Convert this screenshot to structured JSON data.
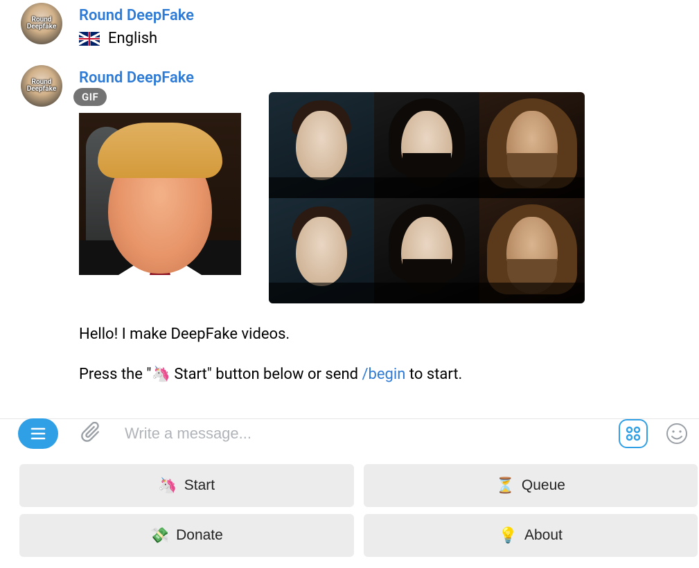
{
  "bot": {
    "name": "Round DeepFake",
    "avatar_label": "Round\nDeepfake"
  },
  "messages": {
    "lang_label": "English",
    "gif_badge": "GIF",
    "greeting": "Hello! I make DeepFake videos.",
    "instruction_pre": "Press the \"",
    "instruction_button_emoji": "🦄",
    "instruction_button_label": " Start",
    "instruction_mid": "\" button below or send ",
    "instruction_command": "/begin",
    "instruction_post": " to start."
  },
  "composer": {
    "placeholder": "Write a message..."
  },
  "keyboard": {
    "start": {
      "emoji": "🦄",
      "label": "Start"
    },
    "queue": {
      "emoji": "⏳",
      "label": "Queue"
    },
    "donate": {
      "emoji": "💸",
      "label": "Donate"
    },
    "about": {
      "emoji": "💡",
      "label": "About"
    }
  }
}
